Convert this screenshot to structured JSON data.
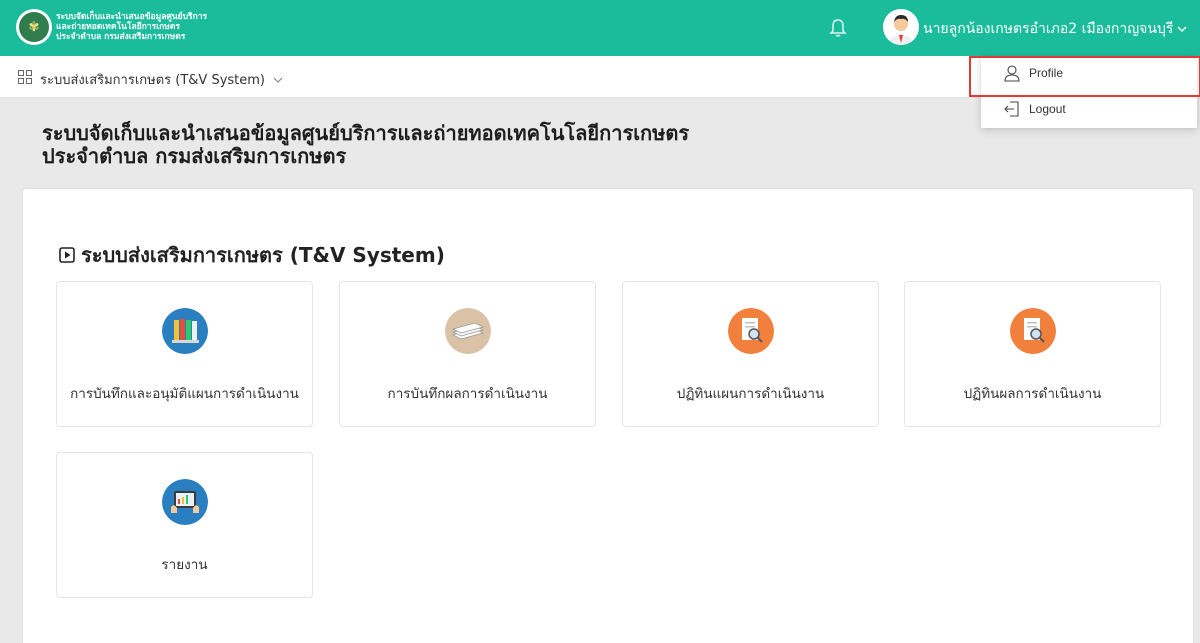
{
  "header": {
    "brand_line1": "ระบบจัดเก็บและนำเสนอข้อมูลศูนย์บริการ",
    "brand_line2": "และถ่ายทอดเทคโนโลยีการเกษตร",
    "brand_line3": "ประจำตำบล กรมส่งเสริมการเกษตร",
    "user_name": "นายลูกน้องเกษตรอำเภอ2 เมืองกาญจนบุรี",
    "accent_color": "#1abc9c"
  },
  "subbar": {
    "system_label": "ระบบส่งเสริมการเกษตร (T&V System)"
  },
  "user_menu": {
    "profile_label": "Profile",
    "logout_label": "Logout"
  },
  "page": {
    "title_line1": "ระบบจัดเก็บและนำเสนอข้อมูลศูนย์บริการและถ่ายทอดเทคโนโลยีการเกษตร",
    "title_line2": "ประจำตำบล กรมส่งเสริมการเกษตร"
  },
  "section": {
    "title": "ระบบส่งเสริมการเกษตร (T&V System)"
  },
  "cards": [
    {
      "label": "การบันทึกและอนุมัติแผนการดำเนินงาน",
      "icon": "books-icon"
    },
    {
      "label": "การบันทึกผลการดำเนินงาน",
      "icon": "papers-stack-icon"
    },
    {
      "label": "ปฏิทินแผนการดำเนินงาน",
      "icon": "document-search-icon"
    },
    {
      "label": "ปฏิทินผลการดำเนินงาน",
      "icon": "document-search-icon"
    },
    {
      "label": "รายงาน",
      "icon": "tablet-report-icon"
    }
  ]
}
